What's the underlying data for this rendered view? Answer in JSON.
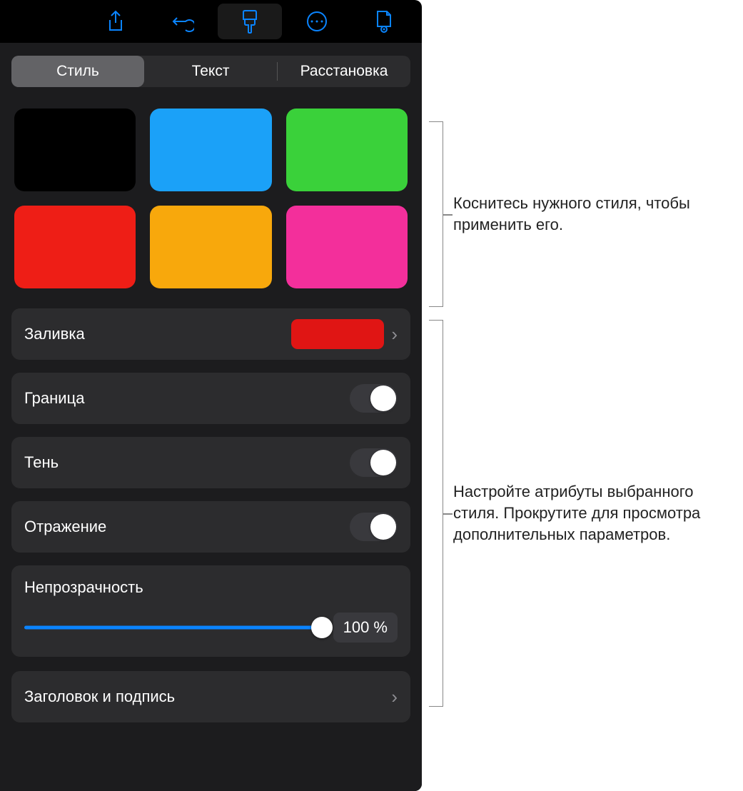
{
  "toolbar": {
    "icons": [
      "share-icon",
      "undo-icon",
      "format-brush-icon",
      "more-icon",
      "document-view-icon"
    ],
    "activeIndex": 2
  },
  "segments": {
    "items": [
      "Стиль",
      "Текст",
      "Расстановка"
    ],
    "selectedIndex": 0
  },
  "swatches": [
    "#000000",
    "#1ba1f8",
    "#3ad13a",
    "#ee1e16",
    "#f8a80c",
    "#f32f9b"
  ],
  "rows": {
    "fill": {
      "label": "Заливка",
      "color": "#e01514"
    },
    "border": {
      "label": "Граница",
      "on": false
    },
    "shadow": {
      "label": "Тень",
      "on": false
    },
    "reflection": {
      "label": "Отражение",
      "on": false
    }
  },
  "opacity": {
    "label": "Непрозрачность",
    "value_text": "100 %",
    "value": 100
  },
  "title_caption": {
    "label": "Заголовок и подпись"
  },
  "callouts": {
    "styles": "Коснитесь нужного стиля, чтобы применить его.",
    "attributes": "Настройте атрибуты выбранного стиля. Прокрутите для просмотра дополнительных параметров."
  }
}
